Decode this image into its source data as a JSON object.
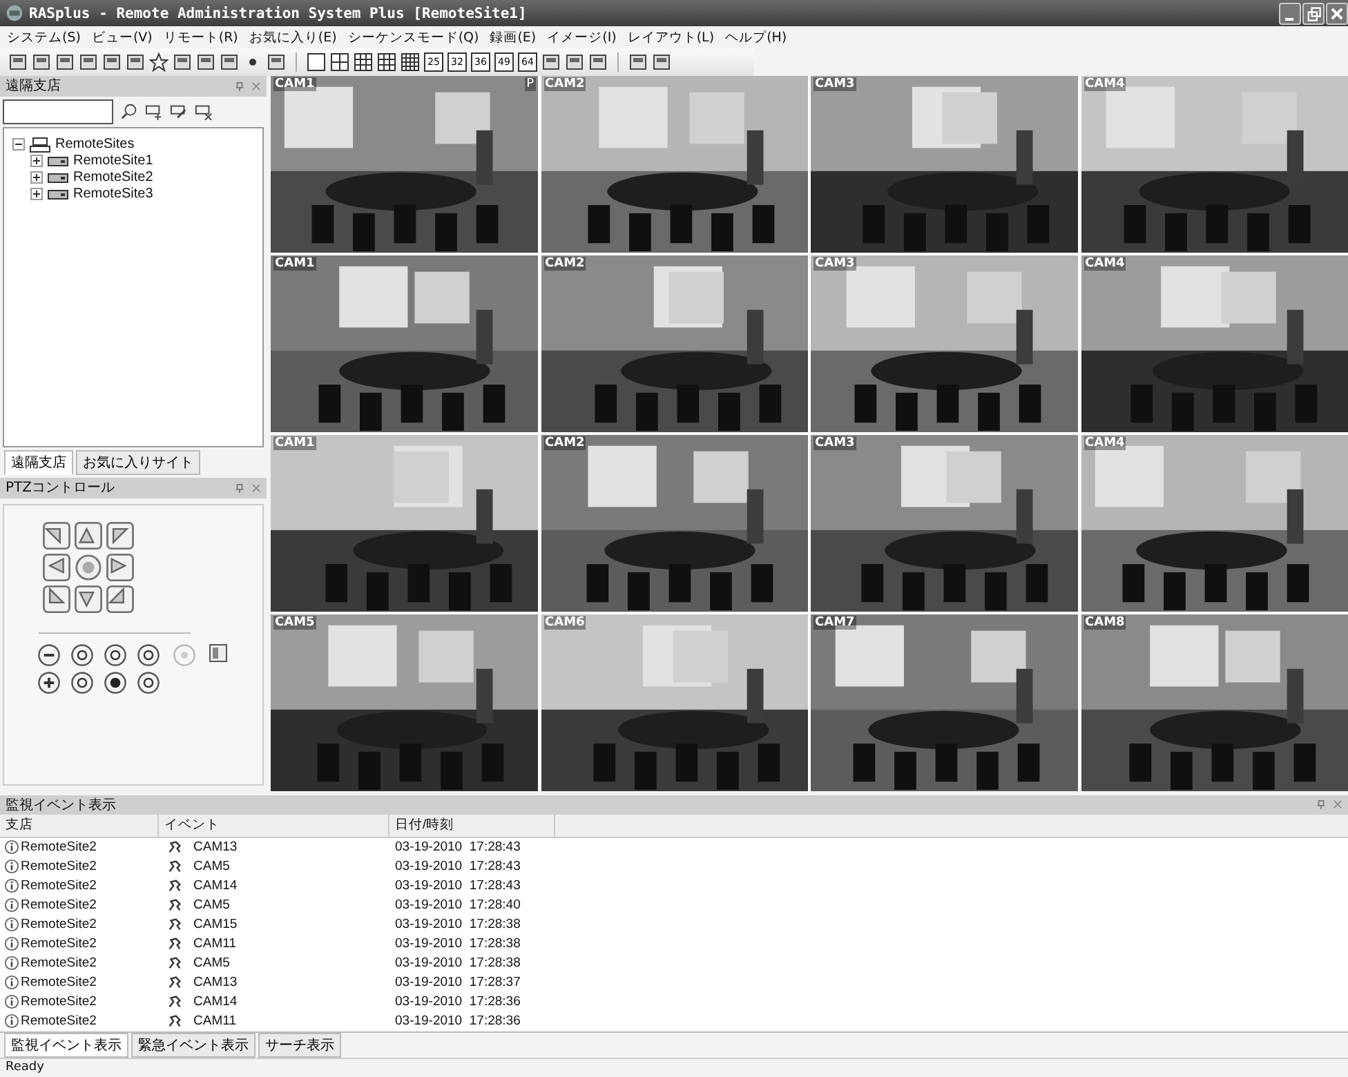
{
  "window": {
    "title": "RASplus - Remote Administration System Plus [RemoteSite1]"
  },
  "menu": [
    "システム(S)",
    "ビュー(V)",
    "リモート(R)",
    "お気に入り(E)",
    "シーケンスモード(Q)",
    "録画(E)",
    "イメージ(I)",
    "レイアウト(L)",
    "ヘルプ(H)"
  ],
  "toolbar": [
    {
      "kind": "icon"
    },
    {
      "kind": "icon"
    },
    {
      "kind": "icon"
    },
    {
      "kind": "icon"
    },
    {
      "kind": "icon"
    },
    {
      "kind": "icon"
    },
    {
      "kind": "star"
    },
    {
      "kind": "icon"
    },
    {
      "kind": "icon"
    },
    {
      "kind": "icon"
    },
    {
      "kind": "dot"
    },
    {
      "kind": "icon"
    },
    {
      "kind": "sep"
    },
    {
      "kind": "grid1"
    },
    {
      "kind": "grid4"
    },
    {
      "kind": "grid6"
    },
    {
      "kind": "grid9"
    },
    {
      "kind": "grid16"
    },
    {
      "kind": "text",
      "label": "25"
    },
    {
      "kind": "text",
      "label": "32"
    },
    {
      "kind": "text",
      "label": "36"
    },
    {
      "kind": "text",
      "label": "49"
    },
    {
      "kind": "text",
      "label": "64"
    },
    {
      "kind": "icon"
    },
    {
      "kind": "icon"
    },
    {
      "kind": "icon"
    },
    {
      "kind": "sep"
    },
    {
      "kind": "icon"
    },
    {
      "kind": "icon"
    }
  ],
  "sites_panel": {
    "title": "遠隔支店",
    "tree": {
      "label": "RemoteSites",
      "expanded": true,
      "children": [
        {
          "label": "RemoteSite1",
          "expanded": false
        },
        {
          "label": "RemoteSite2",
          "expanded": false
        },
        {
          "label": "RemoteSite3",
          "expanded": false
        }
      ]
    },
    "tabs": [
      {
        "label": "遠隔支店",
        "selected": true
      },
      {
        "label": "お気に入りサイト",
        "selected": false
      }
    ]
  },
  "ptz_panel": {
    "title": "PTZコントロール"
  },
  "cameras": [
    {
      "label": "CAM1",
      "marker": "P"
    },
    {
      "label": "CAM2"
    },
    {
      "label": "CAM3"
    },
    {
      "label": "CAM4"
    },
    {
      "label": "CAM1"
    },
    {
      "label": "CAM2"
    },
    {
      "label": "CAM3"
    },
    {
      "label": "CAM4"
    },
    {
      "label": "CAM1"
    },
    {
      "label": "CAM2"
    },
    {
      "label": "CAM3"
    },
    {
      "label": "CAM4"
    },
    {
      "label": "CAM5"
    },
    {
      "label": "CAM6"
    },
    {
      "label": "CAM7"
    },
    {
      "label": "CAM8"
    }
  ],
  "event_panel": {
    "title": "監視イベント表示",
    "columns": [
      "支店",
      "イベント",
      "日付/時刻"
    ],
    "rows": [
      [
        "RemoteSite2",
        "CAM13",
        "03-19-2010  17:28:43"
      ],
      [
        "RemoteSite2",
        "CAM5",
        "03-19-2010  17:28:43"
      ],
      [
        "RemoteSite2",
        "CAM14",
        "03-19-2010  17:28:43"
      ],
      [
        "RemoteSite2",
        "CAM5",
        "03-19-2010  17:28:40"
      ],
      [
        "RemoteSite2",
        "CAM15",
        "03-19-2010  17:28:38"
      ],
      [
        "RemoteSite2",
        "CAM11",
        "03-19-2010  17:28:38"
      ],
      [
        "RemoteSite2",
        "CAM5",
        "03-19-2010  17:28:38"
      ],
      [
        "RemoteSite2",
        "CAM13",
        "03-19-2010  17:28:37"
      ],
      [
        "RemoteSite2",
        "CAM14",
        "03-19-2010  17:28:36"
      ],
      [
        "RemoteSite2",
        "CAM11",
        "03-19-2010  17:28:36"
      ]
    ],
    "tabs": [
      {
        "label": "監視イベント表示",
        "selected": true
      },
      {
        "label": "緊急イベント表示",
        "selected": false
      },
      {
        "label": "サーチ表示",
        "selected": false
      }
    ]
  },
  "status_bar": {
    "text": "Ready"
  }
}
